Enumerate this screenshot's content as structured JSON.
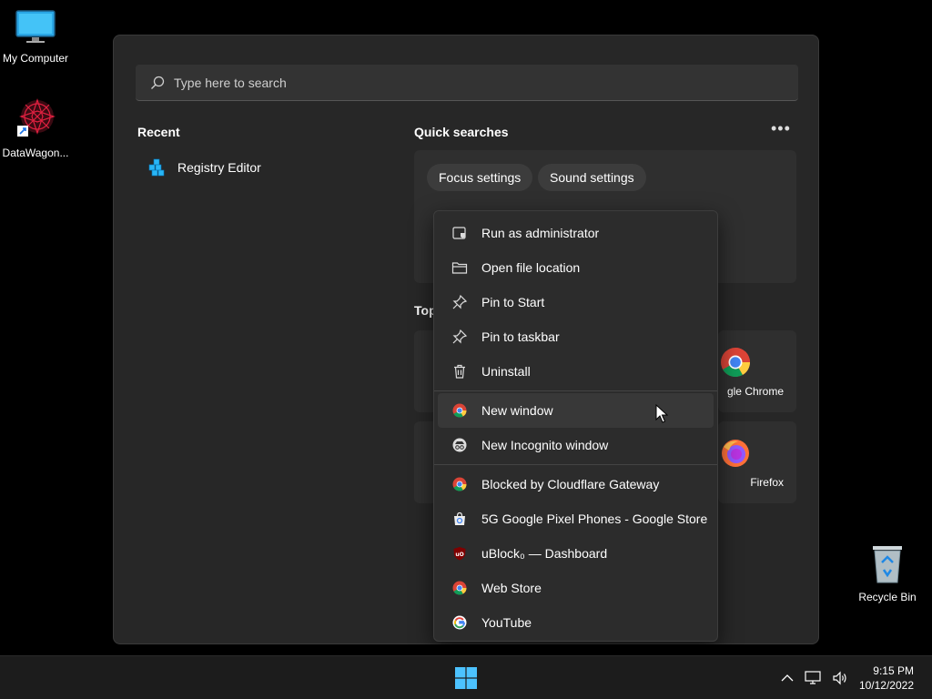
{
  "desktop": {
    "icons": [
      {
        "label": "My Computer"
      },
      {
        "label": "DataWagon..."
      },
      {
        "label": "Recycle Bin"
      }
    ]
  },
  "start_menu": {
    "search": {
      "placeholder": "Type here to search"
    },
    "recent": {
      "title": "Recent",
      "items": [
        {
          "label": "Registry Editor"
        }
      ]
    },
    "quick_searches": {
      "title": "Quick searches",
      "chips": [
        {
          "label": "Focus settings"
        },
        {
          "label": "Sound settings"
        }
      ]
    },
    "top_apps": {
      "title": "Top",
      "apps": [
        {
          "label": "gle Chrome"
        },
        {
          "label": "Firefox"
        }
      ]
    }
  },
  "context_menu": {
    "group1": [
      {
        "label": "Run as administrator",
        "icon": "shield-icon"
      },
      {
        "label": "Open file location",
        "icon": "folder-icon"
      },
      {
        "label": "Pin to Start",
        "icon": "pin-icon"
      },
      {
        "label": "Pin to taskbar",
        "icon": "pin-icon"
      },
      {
        "label": "Uninstall",
        "icon": "trash-icon"
      }
    ],
    "group2": [
      {
        "label": "New window",
        "icon": "chrome-icon"
      },
      {
        "label": "New Incognito window",
        "icon": "incognito-icon"
      }
    ],
    "group3": [
      {
        "label": "Blocked by Cloudflare Gateway",
        "icon": "chrome-icon"
      },
      {
        "label": "5G Google Pixel Phones - Google Store",
        "icon": "google-store-icon"
      },
      {
        "label": "uBlock₀ — Dashboard",
        "icon": "ublock-icon"
      },
      {
        "label": "Web Store",
        "icon": "chrome-icon"
      },
      {
        "label": "YouTube",
        "icon": "google-icon"
      }
    ]
  },
  "taskbar": {
    "time": "9:15 PM",
    "date": "10/12/2022"
  },
  "colors": {
    "panel": "#272727",
    "menu": "#2c2c2c",
    "accent": "#4cc2ff"
  }
}
